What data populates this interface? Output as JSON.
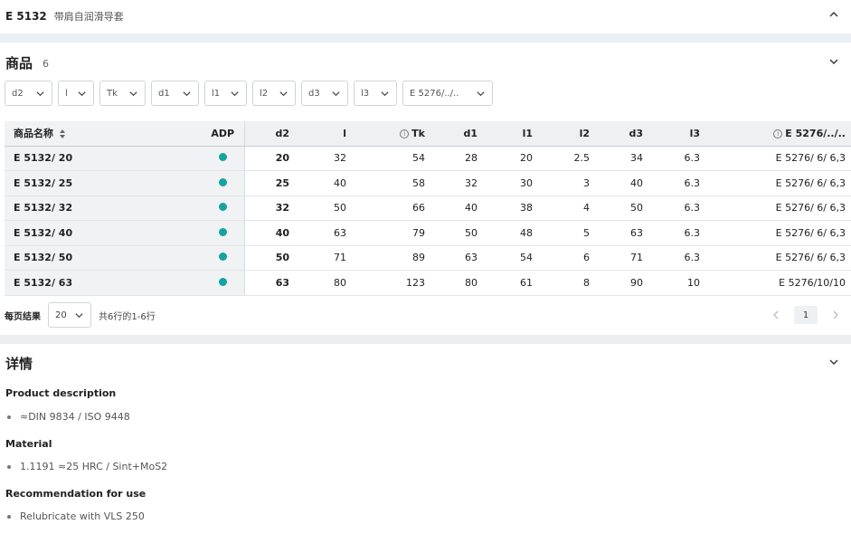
{
  "header": {
    "code": "E 5132",
    "subtitle": "带肩自润滑导套"
  },
  "products": {
    "title": "商品",
    "count": "6",
    "filters": [
      "d2",
      "l",
      "Tk",
      "d1",
      "l1",
      "l2",
      "d3",
      "l3",
      "E 5276/../.."
    ],
    "columns": {
      "name": "商品名称",
      "adp": "ADP",
      "d2": "d2",
      "l": "l",
      "tk": "Tk",
      "d1": "d1",
      "l1": "l1",
      "l2": "l2",
      "d3": "d3",
      "l3": "l3",
      "e5276": "E 5276/../.."
    },
    "rows": [
      {
        "name": "E 5132/ 20",
        "d2": "20",
        "l": "32",
        "tk": "54",
        "d1": "28",
        "l1": "20",
        "l2": "2.5",
        "d3": "34",
        "l3": "6.3",
        "e5276": "E 5276/ 6/ 6,3"
      },
      {
        "name": "E 5132/ 25",
        "d2": "25",
        "l": "40",
        "tk": "58",
        "d1": "32",
        "l1": "30",
        "l2": "3",
        "d3": "40",
        "l3": "6.3",
        "e5276": "E 5276/ 6/ 6,3"
      },
      {
        "name": "E 5132/ 32",
        "d2": "32",
        "l": "50",
        "tk": "66",
        "d1": "40",
        "l1": "38",
        "l2": "4",
        "d3": "50",
        "l3": "6.3",
        "e5276": "E 5276/ 6/ 6,3"
      },
      {
        "name": "E 5132/ 40",
        "d2": "40",
        "l": "63",
        "tk": "79",
        "d1": "50",
        "l1": "48",
        "l2": "5",
        "d3": "63",
        "l3": "6.3",
        "e5276": "E 5276/ 6/ 6,3"
      },
      {
        "name": "E 5132/ 50",
        "d2": "50",
        "l": "71",
        "tk": "89",
        "d1": "63",
        "l1": "54",
        "l2": "6",
        "d3": "71",
        "l3": "6.3",
        "e5276": "E 5276/ 6/ 6,3"
      },
      {
        "name": "E 5132/ 63",
        "d2": "63",
        "l": "80",
        "tk": "123",
        "d1": "80",
        "l1": "61",
        "l2": "8",
        "d3": "90",
        "l3": "10",
        "e5276": "E 5276/10/10"
      }
    ],
    "pagination": {
      "per_page_label": "每页结果",
      "per_page_value": "20",
      "range_text": "共6行的1-6行",
      "current_page": "1"
    }
  },
  "details": {
    "title": "详情",
    "sections": [
      {
        "heading": "Product description",
        "item": "≈DIN 9834 / ISO 9448"
      },
      {
        "heading": "Material",
        "item": "1.1191 ≈25 HRC / Sint+MoS2"
      },
      {
        "heading": "Recommendation for use",
        "item": "Relubricate with VLS 250"
      }
    ]
  },
  "colors": {
    "adp_dot": "#13a3a0",
    "divider": "#eceff2"
  }
}
